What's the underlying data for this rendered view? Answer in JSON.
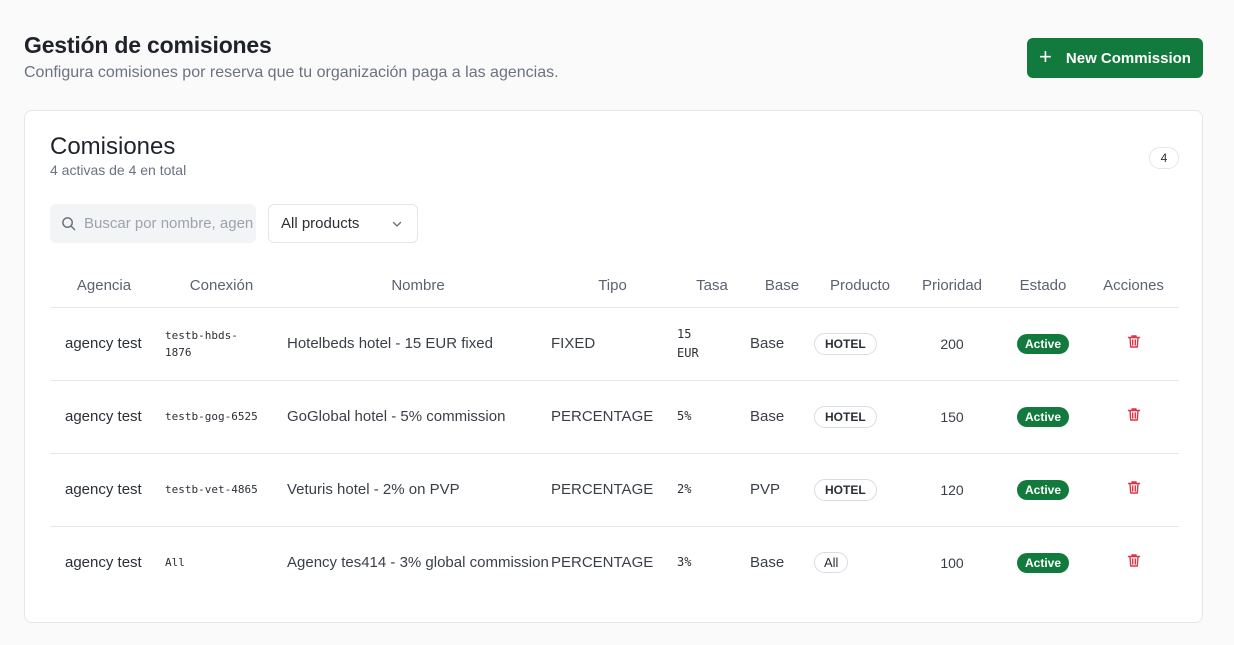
{
  "header": {
    "title": "Gestión de comisiones",
    "subtitle": "Configura comisiones por reserva que tu organización paga a las agencias.",
    "new_button": "New Commission"
  },
  "card": {
    "title": "Comisiones",
    "subtitle": "4 activas de 4 en total",
    "count": "4"
  },
  "filters": {
    "search_placeholder": "Buscar por nombre, agencia...",
    "product_select": "All products"
  },
  "table": {
    "columns": [
      "Agencia",
      "Conexión",
      "Nombre",
      "Tipo",
      "Tasa",
      "Base",
      "Producto",
      "Prioridad",
      "Estado",
      "Acciones"
    ],
    "rows": [
      {
        "agencia": "agency test",
        "conexion": "testb-hbds-1876",
        "nombre": "Hotelbeds hotel - 15 EUR fixed",
        "tipo": "FIXED",
        "tasa": "15 EUR",
        "base": "Base",
        "producto": "HOTEL",
        "prioridad": "200",
        "estado": "Active"
      },
      {
        "agencia": "agency test",
        "conexion": "testb-gog-6525",
        "nombre": "GoGlobal hotel - 5% commission",
        "tipo": "PERCENTAGE",
        "tasa": "5%",
        "base": "Base",
        "producto": "HOTEL",
        "prioridad": "150",
        "estado": "Active"
      },
      {
        "agencia": "agency test",
        "conexion": "testb-vet-4865",
        "nombre": "Veturis hotel - 2% on PVP",
        "tipo": "PERCENTAGE",
        "tasa": "2%",
        "base": "PVP",
        "producto": "HOTEL",
        "prioridad": "120",
        "estado": "Active"
      },
      {
        "agencia": "agency test",
        "conexion": "All",
        "nombre": "Agency tes414 - 3% global commission",
        "tipo": "PERCENTAGE",
        "tasa": "3%",
        "base": "Base",
        "producto": "All",
        "prioridad": "100",
        "estado": "Active"
      }
    ]
  },
  "icons": {
    "new_button": "plus-icon",
    "search": "search-icon",
    "select": "chevron-down-icon",
    "delete": "trash-icon"
  },
  "colors": {
    "primary": "#127a3c",
    "danger": "#dc3545"
  }
}
